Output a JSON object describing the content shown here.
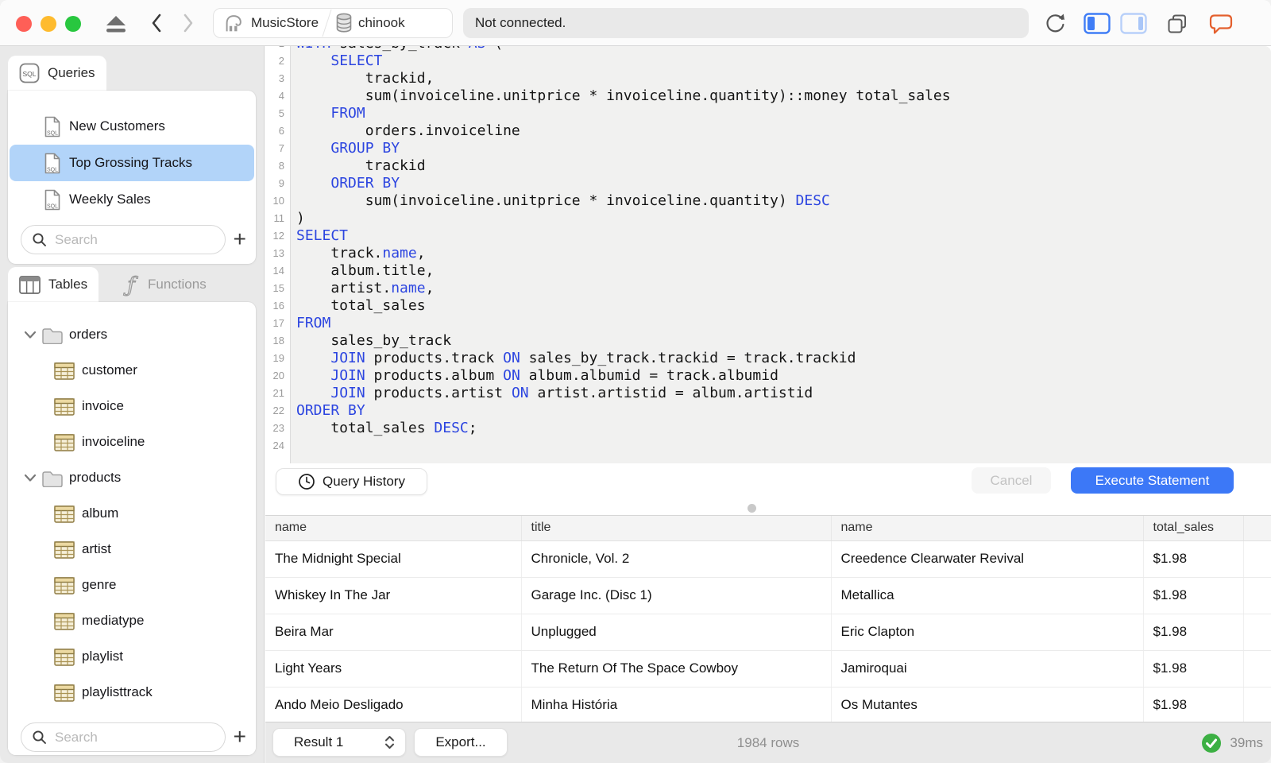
{
  "toolbar": {
    "breadcrumb": {
      "server": "MusicStore",
      "database": "chinook"
    },
    "status": "Not connected."
  },
  "sidebar": {
    "queries": {
      "tab_label": "Queries",
      "items": [
        {
          "label": "New Customers",
          "selected": false
        },
        {
          "label": "Top Grossing Tracks",
          "selected": true
        },
        {
          "label": "Weekly Sales",
          "selected": false
        }
      ],
      "search_placeholder": "Search",
      "add_label": "+"
    },
    "schema": {
      "tables_tab_label": "Tables",
      "functions_tab_label": "Functions",
      "tree": [
        {
          "type": "folder",
          "label": "orders",
          "expanded": true
        },
        {
          "type": "table",
          "label": "customer"
        },
        {
          "type": "table",
          "label": "invoice"
        },
        {
          "type": "table",
          "label": "invoiceline"
        },
        {
          "type": "folder",
          "label": "products",
          "expanded": true
        },
        {
          "type": "table",
          "label": "album"
        },
        {
          "type": "table",
          "label": "artist"
        },
        {
          "type": "table",
          "label": "genre"
        },
        {
          "type": "table",
          "label": "mediatype"
        },
        {
          "type": "table",
          "label": "playlist"
        },
        {
          "type": "table",
          "label": "playlisttrack"
        }
      ],
      "search_placeholder": "Search",
      "add_label": "+"
    }
  },
  "editor": {
    "keyword_color": "#2c45e0",
    "lines": [
      [
        [
          "kw",
          "WITH"
        ],
        [
          "tx",
          " sales_by_track "
        ],
        [
          "kw",
          "AS"
        ],
        [
          "tx",
          " ("
        ]
      ],
      [
        [
          "tx",
          "    "
        ],
        [
          "kw",
          "SELECT"
        ]
      ],
      [
        [
          "tx",
          "        trackid,"
        ]
      ],
      [
        [
          "tx",
          "        sum(invoiceline.unitprice * invoiceline.quantity)::money total_sales"
        ]
      ],
      [
        [
          "tx",
          "    "
        ],
        [
          "kw",
          "FROM"
        ]
      ],
      [
        [
          "tx",
          "        orders.invoiceline"
        ]
      ],
      [
        [
          "tx",
          "    "
        ],
        [
          "kw",
          "GROUP BY"
        ]
      ],
      [
        [
          "tx",
          "        trackid"
        ]
      ],
      [
        [
          "tx",
          "    "
        ],
        [
          "kw",
          "ORDER BY"
        ]
      ],
      [
        [
          "tx",
          "        sum(invoiceline.unitprice * invoiceline.quantity) "
        ],
        [
          "kw",
          "DESC"
        ]
      ],
      [
        [
          "tx",
          ")"
        ]
      ],
      [
        [
          "kw",
          "SELECT"
        ]
      ],
      [
        [
          "tx",
          "    track."
        ],
        [
          "kw",
          "name"
        ],
        [
          "tx",
          ","
        ]
      ],
      [
        [
          "tx",
          "    album.title,"
        ]
      ],
      [
        [
          "tx",
          "    artist."
        ],
        [
          "kw",
          "name"
        ],
        [
          "tx",
          ","
        ]
      ],
      [
        [
          "tx",
          "    total_sales"
        ]
      ],
      [
        [
          "kw",
          "FROM"
        ]
      ],
      [
        [
          "tx",
          "    sales_by_track"
        ]
      ],
      [
        [
          "tx",
          "    "
        ],
        [
          "kw",
          "JOIN"
        ],
        [
          "tx",
          " products.track "
        ],
        [
          "kw",
          "ON"
        ],
        [
          "tx",
          " sales_by_track.trackid = track.trackid"
        ]
      ],
      [
        [
          "tx",
          "    "
        ],
        [
          "kw",
          "JOIN"
        ],
        [
          "tx",
          " products.album "
        ],
        [
          "kw",
          "ON"
        ],
        [
          "tx",
          " album.albumid = track.albumid"
        ]
      ],
      [
        [
          "tx",
          "    "
        ],
        [
          "kw",
          "JOIN"
        ],
        [
          "tx",
          " products.artist "
        ],
        [
          "kw",
          "ON"
        ],
        [
          "tx",
          " artist.artistid = album.artistid"
        ]
      ],
      [
        [
          "kw",
          "ORDER BY"
        ]
      ],
      [
        [
          "tx",
          "    total_sales "
        ],
        [
          "kw",
          "DESC"
        ],
        [
          "tx",
          ";"
        ]
      ],
      []
    ]
  },
  "editor_actions": {
    "query_history": "Query History",
    "cancel": "Cancel",
    "execute": "Execute Statement"
  },
  "results": {
    "columns": [
      "name",
      "title",
      "name",
      "total_sales"
    ],
    "rows": [
      [
        "The Midnight Special",
        "Chronicle, Vol. 2",
        "Creedence Clearwater Revival",
        "$1.98"
      ],
      [
        "Whiskey In The Jar",
        "Garage Inc. (Disc 1)",
        "Metallica",
        "$1.98"
      ],
      [
        "Beira Mar",
        "Unplugged",
        "Eric Clapton",
        "$1.98"
      ],
      [
        "Light Years",
        "The Return Of The Space Cowboy",
        "Jamiroquai",
        "$1.98"
      ],
      [
        "Ando Meio Desligado",
        "Minha História",
        "Os Mutantes",
        "$1.98"
      ]
    ]
  },
  "status_bar": {
    "result_selector": "Result 1",
    "export_label": "Export...",
    "row_count": "1984 rows",
    "duration": "39ms",
    "success_color": "#3cb043"
  }
}
